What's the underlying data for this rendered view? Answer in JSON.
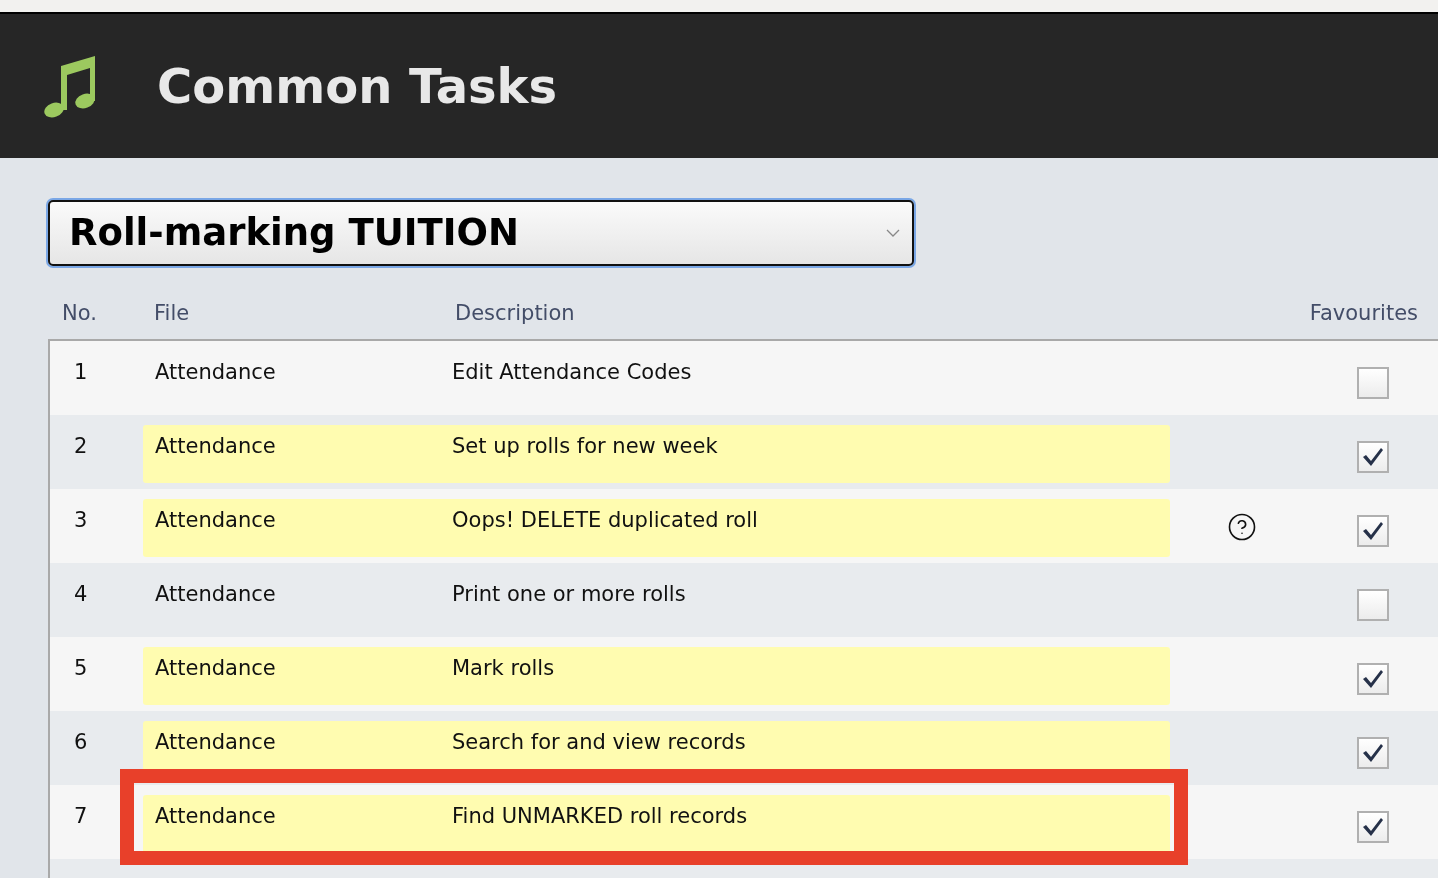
{
  "header": {
    "title": "Common Tasks"
  },
  "task_set_select": {
    "value": "Roll-marking TUITION",
    "focused": true
  },
  "table": {
    "columns": [
      {
        "label": "No."
      },
      {
        "label": "File"
      },
      {
        "label": "Description"
      },
      {
        "label": "Favourites"
      }
    ],
    "rows": [
      {
        "no": "1",
        "file": "Attendance",
        "description": "Edit Attendance Codes",
        "highlighted": false,
        "help_icon": false,
        "favourite": false,
        "outlined": false
      },
      {
        "no": "2",
        "file": "Attendance",
        "description": "Set up rolls for new week",
        "highlighted": true,
        "help_icon": false,
        "favourite": true,
        "outlined": false
      },
      {
        "no": "3",
        "file": "Attendance",
        "description": "Oops! DELETE duplicated roll",
        "highlighted": true,
        "help_icon": true,
        "favourite": true,
        "outlined": false
      },
      {
        "no": "4",
        "file": "Attendance",
        "description": "Print one or more rolls",
        "highlighted": false,
        "help_icon": false,
        "favourite": false,
        "outlined": false
      },
      {
        "no": "5",
        "file": "Attendance",
        "description": "Mark rolls",
        "highlighted": true,
        "help_icon": false,
        "favourite": true,
        "outlined": false
      },
      {
        "no": "6",
        "file": "Attendance",
        "description": "Search for and view records",
        "highlighted": true,
        "help_icon": false,
        "favourite": true,
        "outlined": false
      },
      {
        "no": "7",
        "file": "Attendance",
        "description": "Find UNMARKED roll records",
        "highlighted": true,
        "help_icon": false,
        "favourite": true,
        "outlined": true
      }
    ]
  }
}
